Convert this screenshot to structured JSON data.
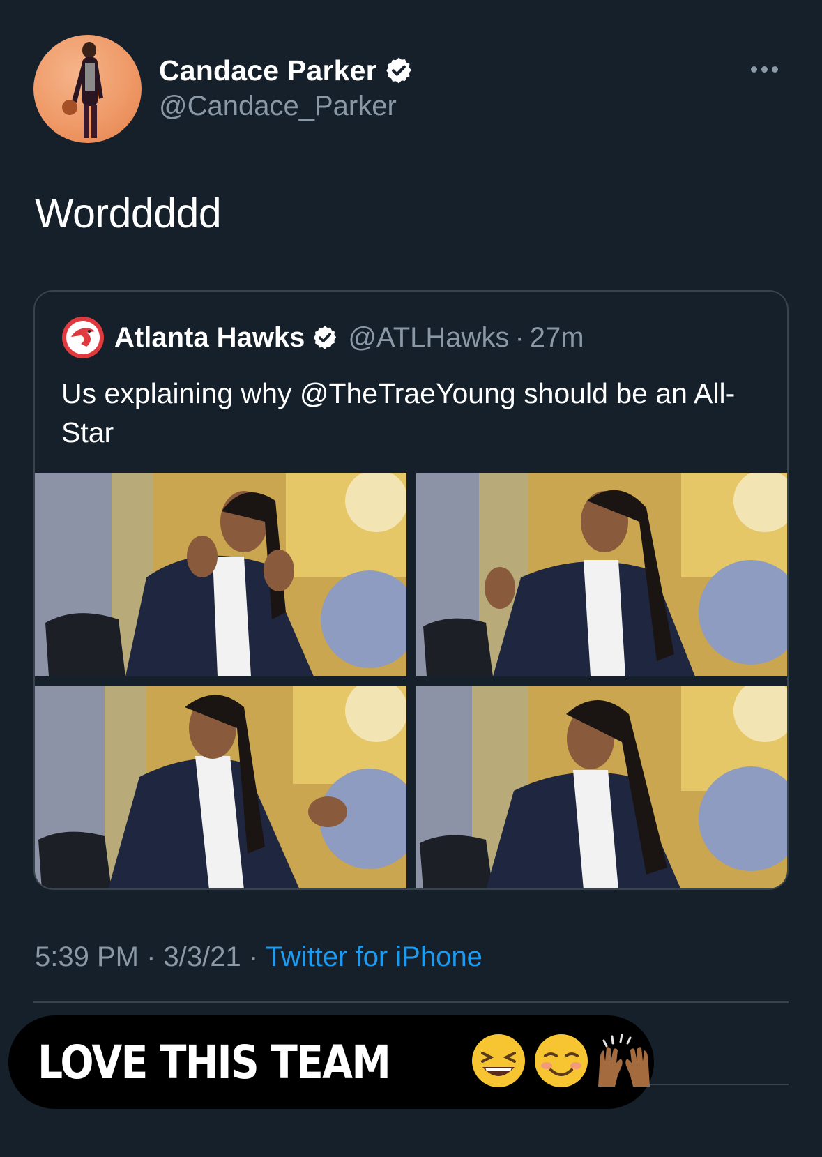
{
  "tweet": {
    "author": {
      "display_name": "Candace Parker",
      "handle": "@Candace_Parker",
      "verified": true
    },
    "text": "Worddddd",
    "quoted": {
      "display_name": "Atlanta Hawks",
      "handle": "@ATLHawks",
      "separator": "·",
      "time_ago": "27m",
      "verified": true,
      "text": "Us explaining why @TheTraeYoung should be an All-Star",
      "media_count": 4
    },
    "meta": {
      "time": "5:39 PM",
      "sep1": " · ",
      "date": "3/3/21",
      "sep2": " · ",
      "source": "Twitter for iPhone"
    }
  },
  "caption": {
    "text": "LOVE THIS TEAM",
    "emojis": [
      "laughing-face",
      "smiling-face",
      "raising-hands"
    ]
  },
  "colors": {
    "background": "#15202b",
    "secondary_text": "#8b98a5",
    "link": "#1d9bf0",
    "border": "#38444d"
  }
}
